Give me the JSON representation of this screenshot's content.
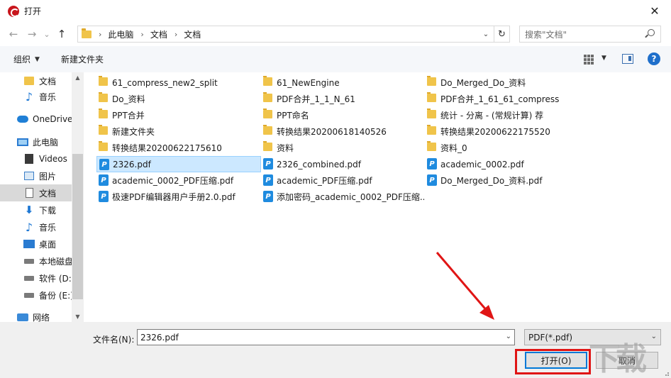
{
  "window": {
    "title": "打开",
    "close_glyph": "✕"
  },
  "nav": {
    "back": "←",
    "forward": "→",
    "recent": "⌄",
    "up": "↑",
    "breadcrumbs": [
      "此电脑",
      "文档",
      "文档"
    ],
    "search_placeholder": "搜索\"文档\""
  },
  "toolbar": {
    "organize": "组织",
    "new_folder": "新建文件夹",
    "help": "?"
  },
  "sidebar": {
    "items": [
      {
        "label": "文档",
        "icon": "folder-icon"
      },
      {
        "label": "音乐",
        "icon": "music-icon"
      },
      {
        "label": "OneDrive",
        "icon": "onedrive-icon"
      },
      {
        "label": "此电脑",
        "icon": "pc-icon"
      },
      {
        "label": "Videos",
        "icon": "video-icon"
      },
      {
        "label": "图片",
        "icon": "pictures-icon"
      },
      {
        "label": "文档",
        "icon": "documents-icon"
      },
      {
        "label": "下载",
        "icon": "download-icon"
      },
      {
        "label": "音乐",
        "icon": "music-icon"
      },
      {
        "label": "桌面",
        "icon": "desktop-icon"
      },
      {
        "label": "本地磁盘",
        "icon": "drive-icon"
      },
      {
        "label": "软件 (D:)",
        "icon": "drive-icon"
      },
      {
        "label": "备份 (E:)",
        "icon": "drive-icon"
      },
      {
        "label": "网络",
        "icon": "network-icon"
      }
    ]
  },
  "files": {
    "col1": [
      {
        "name": "61_compress_new2_split",
        "type": "folder"
      },
      {
        "name": "Do_资料",
        "type": "folder"
      },
      {
        "name": "PPT合并",
        "type": "folder"
      },
      {
        "name": "新建文件夹",
        "type": "folder"
      },
      {
        "name": "转换结果20200622175610",
        "type": "folder"
      },
      {
        "name": "2326.pdf",
        "type": "pdf",
        "selected": true
      },
      {
        "name": "academic_0002_PDF压缩.pdf",
        "type": "pdf"
      },
      {
        "name": "极速PDF编辑器用户手册2.0.pdf",
        "type": "pdf"
      }
    ],
    "col2": [
      {
        "name": "61_NewEngine",
        "type": "folder"
      },
      {
        "name": "PDF合并_1_1_N_61",
        "type": "folder"
      },
      {
        "name": "PPT命名",
        "type": "folder"
      },
      {
        "name": "转换结果20200618140526",
        "type": "folder"
      },
      {
        "name": "资料",
        "type": "folder"
      },
      {
        "name": "2326_combined.pdf",
        "type": "pdf"
      },
      {
        "name": "academic_PDF压缩.pdf",
        "type": "pdf"
      },
      {
        "name": "添加密码_academic_0002_PDF压缩...",
        "type": "pdf"
      }
    ],
    "col3": [
      {
        "name": "Do_Merged_Do_资料",
        "type": "folder"
      },
      {
        "name": "PDF合并_1_61_61_compress",
        "type": "folder"
      },
      {
        "name": "统计 - 分离 - (常规计算) 荐",
        "type": "folder"
      },
      {
        "name": "转换结果20200622175520",
        "type": "folder"
      },
      {
        "name": "资料_0",
        "type": "folder"
      },
      {
        "name": "academic_0002.pdf",
        "type": "pdf"
      },
      {
        "name": "Do_Merged_Do_资料.pdf",
        "type": "pdf"
      }
    ]
  },
  "bottom": {
    "filename_label": "文件名(N):",
    "filename_value": "2326.pdf",
    "filetype": "PDF(*.pdf)",
    "open_label": "打开(O)",
    "cancel_label": "取消"
  },
  "colors": {
    "accent": "#0078d7",
    "highlight": "#e01515",
    "selected_bg": "#cce8ff"
  }
}
